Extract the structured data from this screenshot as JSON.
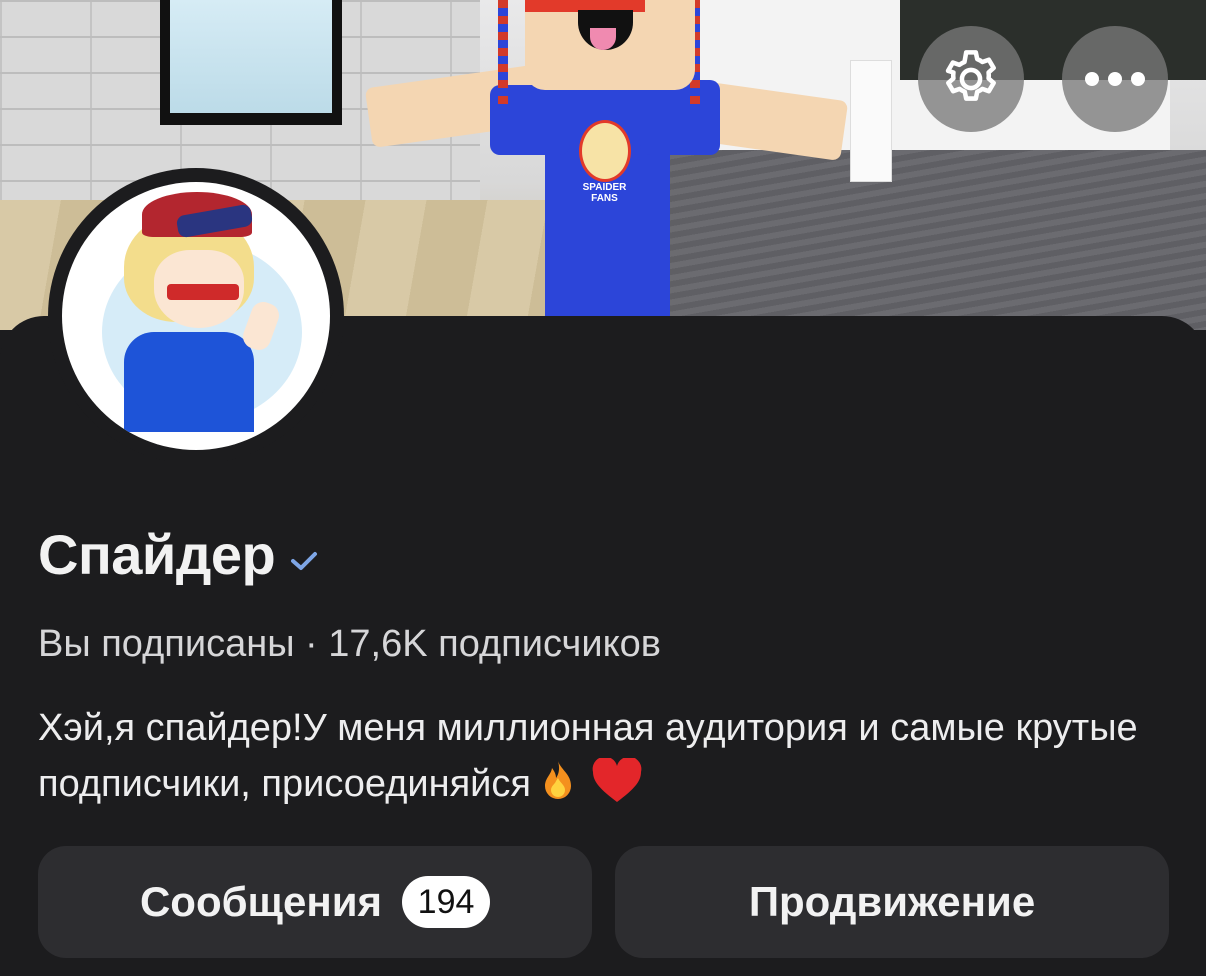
{
  "profile": {
    "name": "Спайдер",
    "verified": true,
    "meta": "Вы подписаны · 17,6K подписчиков",
    "bio_text": "Хэй,я спайдер!У меня миллионная аудитория и самые крутые подписчики, присоединяйся",
    "cover_shirt_text": "SPAIDER FANS"
  },
  "header": {
    "settings_icon": "gear-icon",
    "more_icon": "more-horizontal-icon"
  },
  "actions": {
    "messages_label": "Сообщения",
    "messages_count": "194",
    "promotion_label": "Продвижение"
  },
  "colors": {
    "background": "#1c1c1e",
    "button_bg": "#2d2d30",
    "verified": "#7ea6e6",
    "text_primary": "#f2f2f2"
  }
}
